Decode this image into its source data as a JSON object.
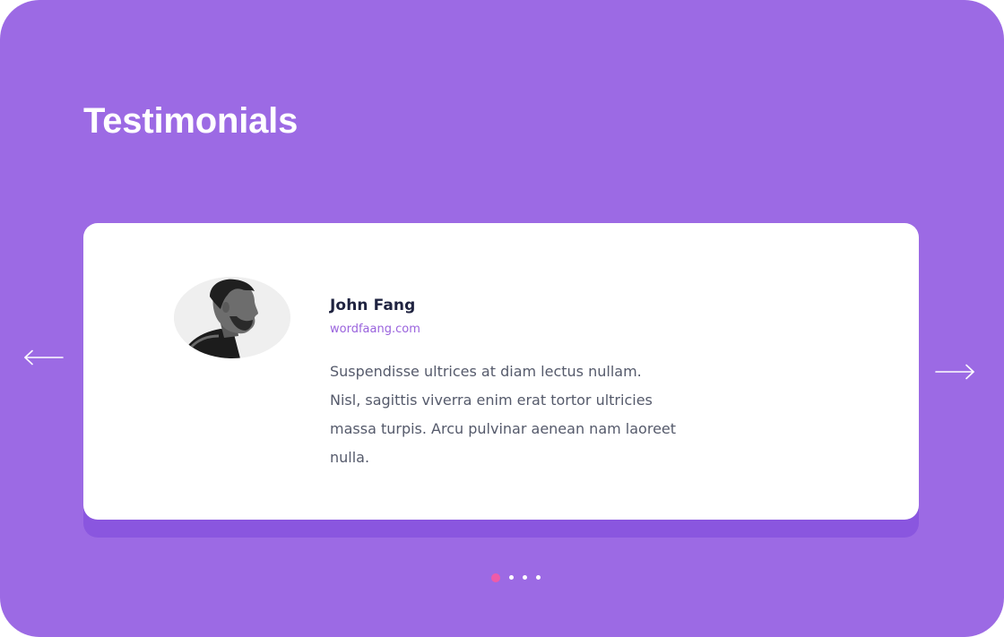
{
  "section": {
    "title": "Testimonials"
  },
  "testimonial": {
    "name": "John Fang",
    "website": "wordfaang.com",
    "quote_lines": [
      "Suspendisse ultrices at diam lectus nullam.",
      "Nisl, sagittis viverra enim erat tortor ultricies",
      "massa turpis. Arcu pulvinar aenean nam laoreet",
      "nulla."
    ]
  },
  "carousel": {
    "prev_icon": "arrow-left-icon",
    "next_icon": "arrow-right-icon",
    "total_slides": 4,
    "active_slide": 1,
    "active_dot_color": "#ef5ba8"
  },
  "colors": {
    "background": "#9c6ae4",
    "card": "#ffffff",
    "card_shadow": "#8a56df",
    "name": "#1f2340",
    "website": "#9a63dd",
    "body_text": "#555a6b"
  }
}
